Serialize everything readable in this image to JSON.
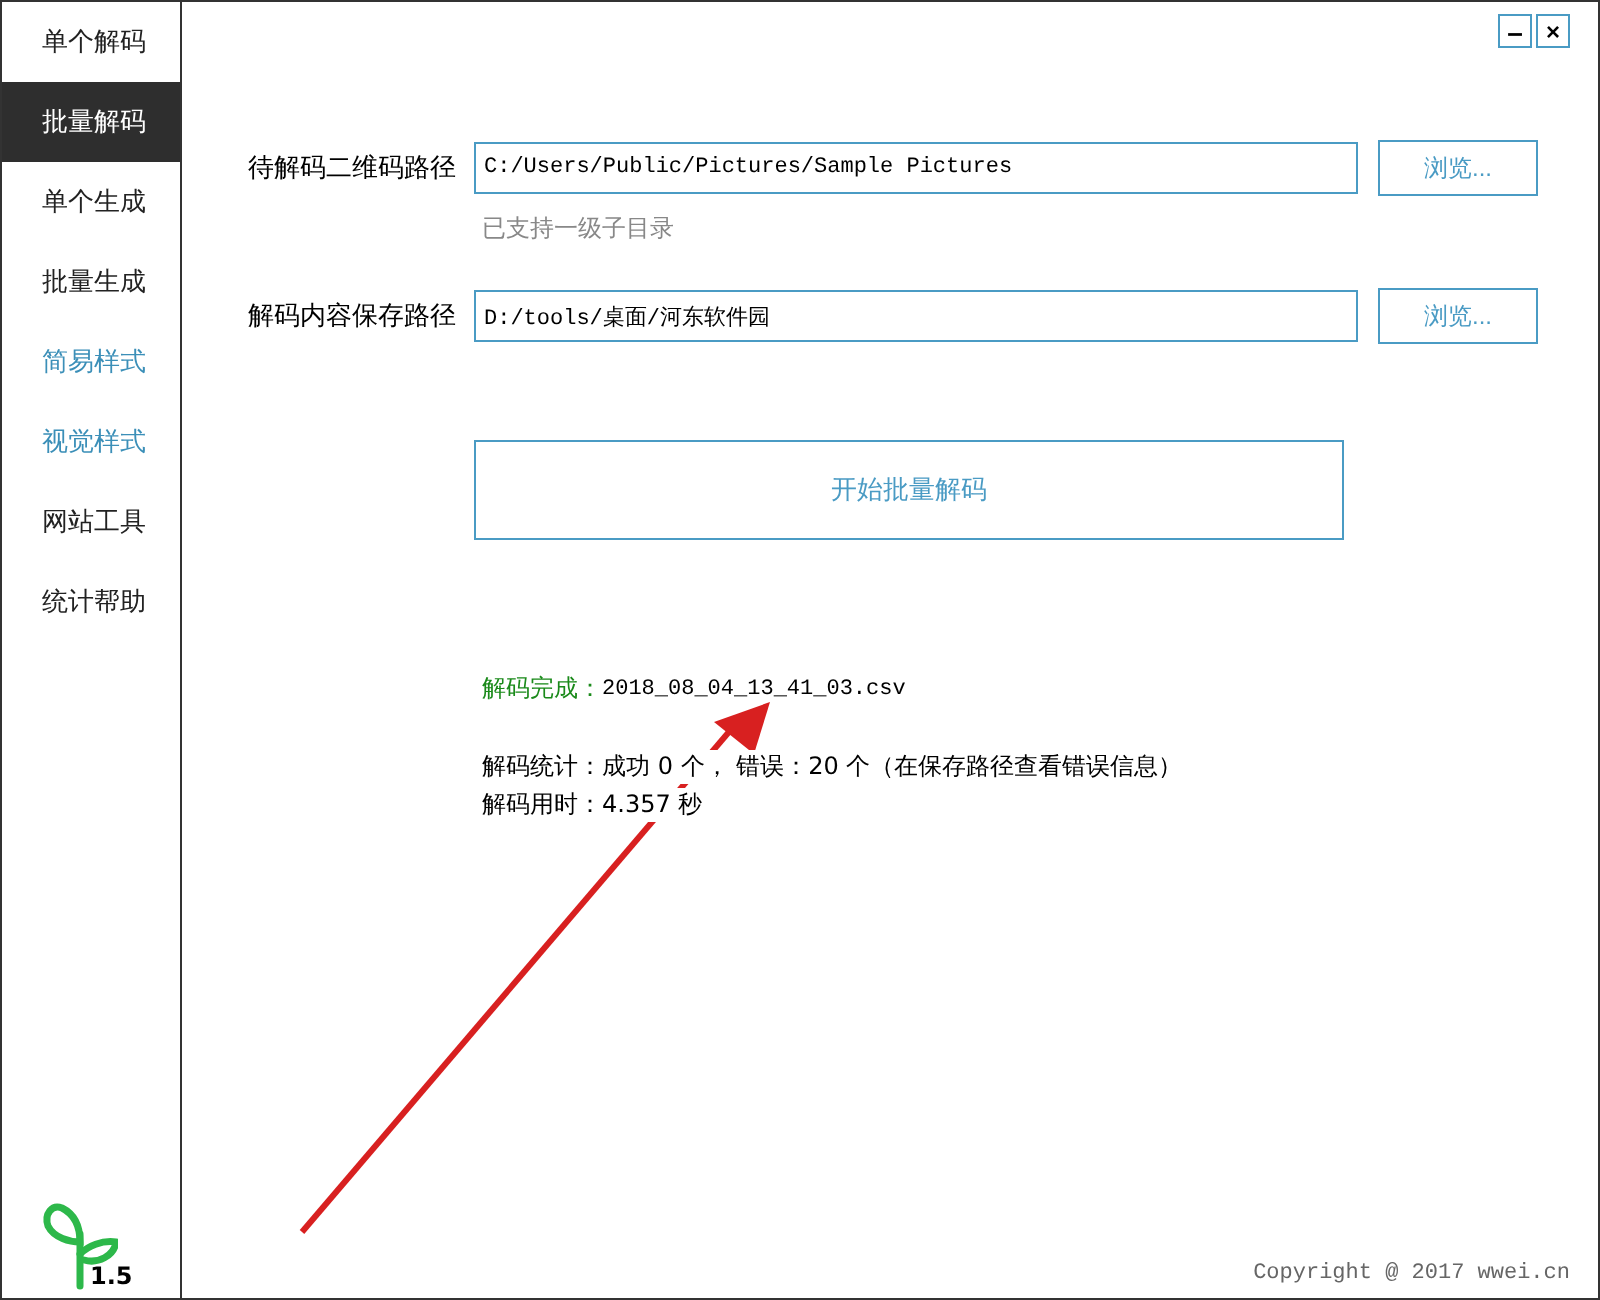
{
  "window_controls": [
    {
      "kind": "minimize",
      "label": "–"
    },
    {
      "kind": "close",
      "label": "×"
    }
  ],
  "sidebar": {
    "items": [
      {
        "label": "单个解码",
        "selected": false,
        "kind": "page"
      },
      {
        "label": "批量解码",
        "selected": true,
        "kind": "page"
      },
      {
        "label": "单个生成",
        "selected": false,
        "kind": "page"
      },
      {
        "label": "批量生成",
        "selected": false,
        "kind": "page"
      },
      {
        "label": "简易样式",
        "selected": false,
        "kind": "link"
      },
      {
        "label": "视觉样式",
        "selected": false,
        "kind": "link"
      },
      {
        "label": "网站工具",
        "selected": false,
        "kind": "page"
      },
      {
        "label": "统计帮助",
        "selected": false,
        "kind": "page"
      }
    ],
    "version": "1.5"
  },
  "fields": [
    {
      "label": "待解码二维码路径",
      "value": "C:/Users/Public/Pictures/Sample Pictures",
      "button": "浏览...",
      "hint": "已支持一级子目录"
    },
    {
      "label": "解码内容保存路径",
      "value": "D:/tools/桌面/河东软件园",
      "button": "浏览..."
    }
  ],
  "start_button": "开始批量解码",
  "result": {
    "status_label": "解码完成：",
    "file": "2018_08_04_13_41_03.csv",
    "stats": "解码统计：成功 0 个， 错误：20 个（在保存路径查看错误信息）",
    "time": "解码用时：4.357 秒"
  },
  "footer": "Copyright @ 2017 wwei.cn"
}
